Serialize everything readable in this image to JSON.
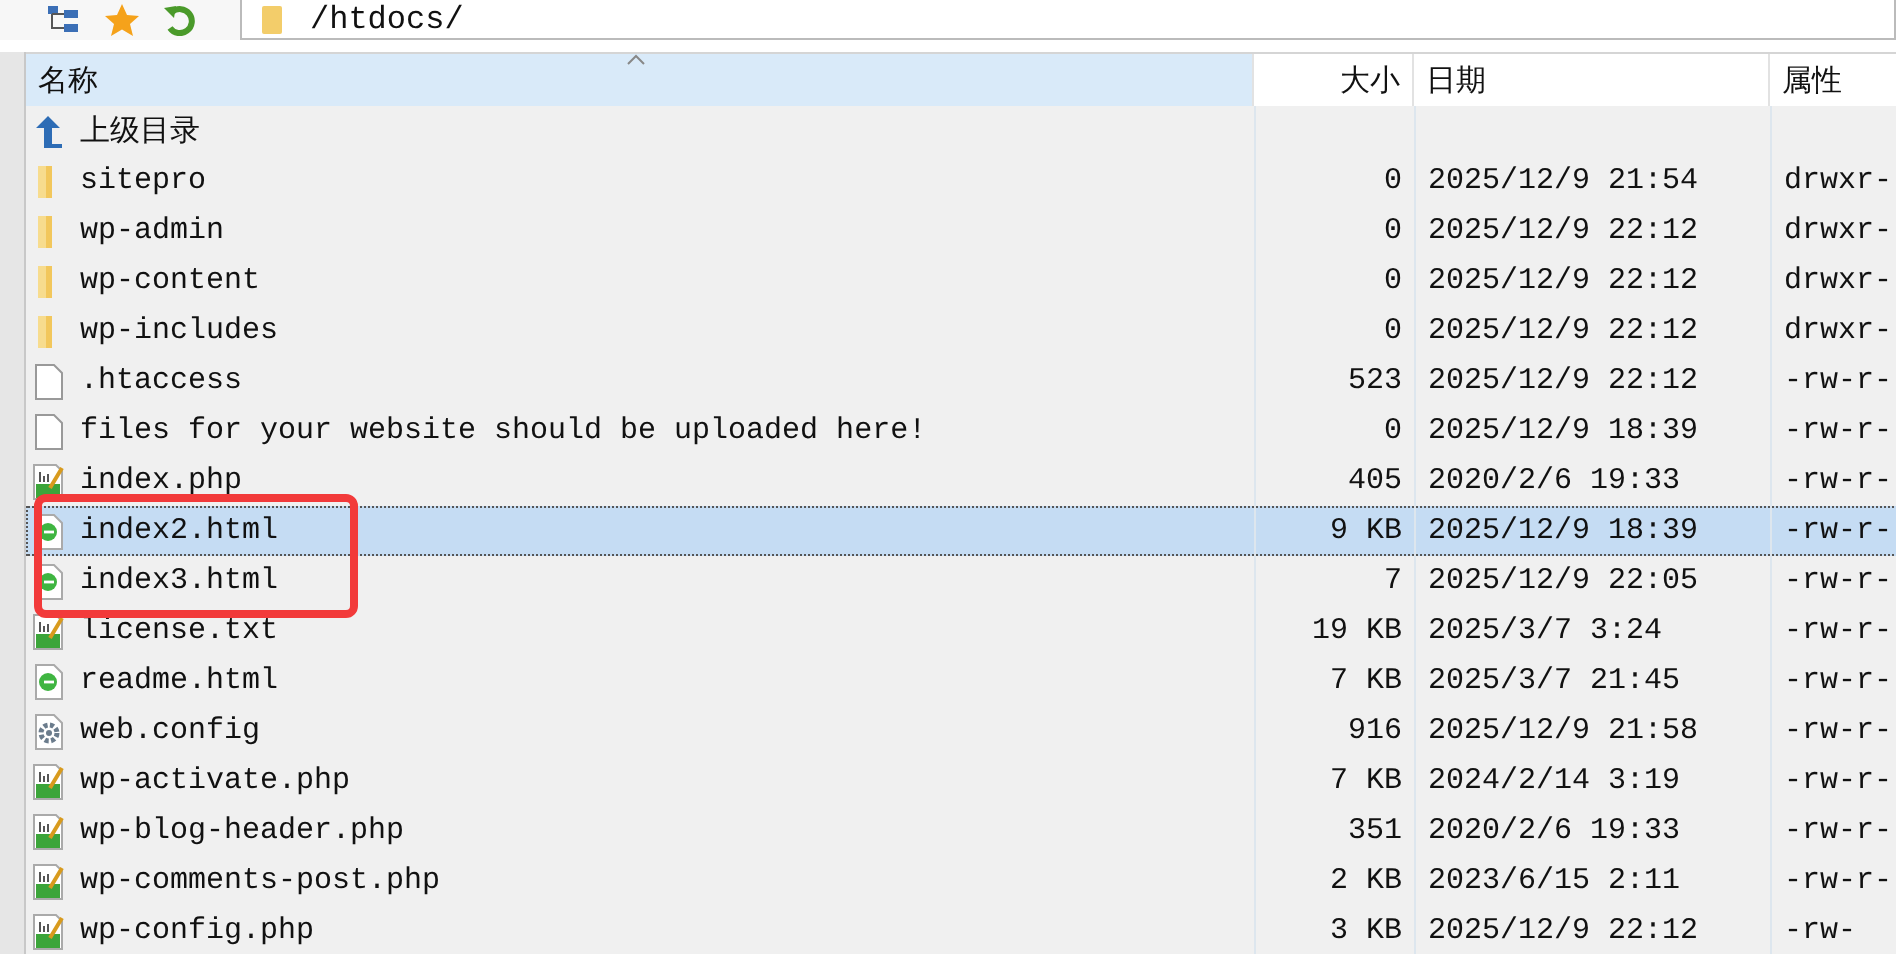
{
  "toolbar": {
    "path": "/htdocs/"
  },
  "columns": [
    {
      "label": "名称",
      "sorted": true
    },
    {
      "label": "大小",
      "sorted": false
    },
    {
      "label": "日期",
      "sorted": false
    },
    {
      "label": "属性",
      "sorted": false
    }
  ],
  "rows": [
    {
      "kind": "up",
      "name": "上级目录",
      "size": "",
      "date": "",
      "attr": "",
      "selected": false,
      "boxed": false
    },
    {
      "kind": "folder",
      "name": "sitepro",
      "size": "0",
      "date": "2025/12/9 21:54",
      "attr": "drwxr-",
      "selected": false,
      "boxed": false
    },
    {
      "kind": "folder",
      "name": "wp-admin",
      "size": "0",
      "date": "2025/12/9 22:12",
      "attr": "drwxr-",
      "selected": false,
      "boxed": false
    },
    {
      "kind": "folder",
      "name": "wp-content",
      "size": "0",
      "date": "2025/12/9 22:12",
      "attr": "drwxr-",
      "selected": false,
      "boxed": false
    },
    {
      "kind": "folder",
      "name": "wp-includes",
      "size": "0",
      "date": "2025/12/9 22:12",
      "attr": "drwxr-",
      "selected": false,
      "boxed": false
    },
    {
      "kind": "file",
      "name": ".htaccess",
      "size": "523",
      "date": "2025/12/9 22:12",
      "attr": "-rw-r-",
      "selected": false,
      "boxed": false
    },
    {
      "kind": "file",
      "name": "files for your website should be uploaded here!",
      "size": "0",
      "date": "2025/12/9 18:39",
      "attr": "-rw-r-",
      "selected": false,
      "boxed": false
    },
    {
      "kind": "php",
      "name": "index.php",
      "size": "405",
      "date": "2020/2/6 19:33",
      "attr": "-rw-r-",
      "selected": false,
      "boxed": false
    },
    {
      "kind": "html",
      "name": "index2.html",
      "size": "9 KB",
      "date": "2025/12/9 18:39",
      "attr": "-rw-r-",
      "selected": true,
      "boxed": true
    },
    {
      "kind": "html",
      "name": "index3.html",
      "size": "7",
      "date": "2025/12/9 22:05",
      "attr": "-rw-r-",
      "selected": false,
      "boxed": true
    },
    {
      "kind": "php",
      "name": "license.txt",
      "size": "19 KB",
      "date": "2025/3/7 3:24",
      "attr": "-rw-r-",
      "selected": false,
      "boxed": false
    },
    {
      "kind": "html",
      "name": "readme.html",
      "size": "7 KB",
      "date": "2025/3/7 21:45",
      "attr": "-rw-r-",
      "selected": false,
      "boxed": false
    },
    {
      "kind": "config",
      "name": "web.config",
      "size": "916",
      "date": "2025/12/9 21:58",
      "attr": "-rw-r-",
      "selected": false,
      "boxed": false
    },
    {
      "kind": "php",
      "name": "wp-activate.php",
      "size": "7 KB",
      "date": "2024/2/14 3:19",
      "attr": "-rw-r-",
      "selected": false,
      "boxed": false
    },
    {
      "kind": "php",
      "name": "wp-blog-header.php",
      "size": "351",
      "date": "2020/2/6 19:33",
      "attr": "-rw-r-",
      "selected": false,
      "boxed": false
    },
    {
      "kind": "php",
      "name": "wp-comments-post.php",
      "size": "2 KB",
      "date": "2023/6/15 2:11",
      "attr": "-rw-r-",
      "selected": false,
      "boxed": false
    },
    {
      "kind": "php",
      "name": "wp-config.php",
      "size": "3 KB",
      "date": "2025/12/9 22:12",
      "attr": "-rw-",
      "selected": false,
      "boxed": false
    }
  ]
}
